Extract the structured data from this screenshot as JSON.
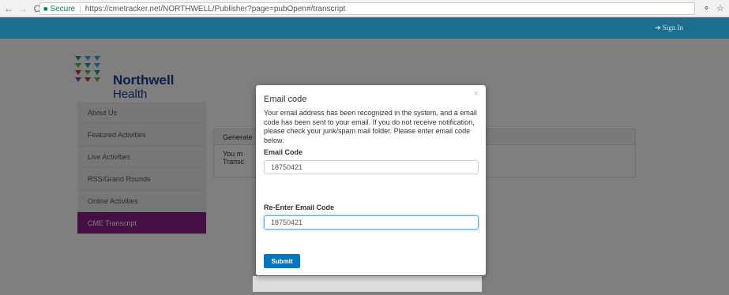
{
  "browser": {
    "back": "←",
    "forward": "→",
    "reload": "C",
    "secure_label": "Secure",
    "url": "https://cmetracker.net/NORTHWELL/Publisher?page=pubOpen#/transcript"
  },
  "header": {
    "signin_label": "Sign In"
  },
  "logo": {
    "line1": "Northwell",
    "line2": "Health"
  },
  "sidebar": {
    "items": [
      {
        "label": "About Us"
      },
      {
        "label": "Featured Activities"
      },
      {
        "label": "Live Activities"
      },
      {
        "label": "RSS/Grand Rounds"
      },
      {
        "label": "Online Activities"
      },
      {
        "label": "CME Transcript"
      }
    ]
  },
  "panel": {
    "heading": "Generate",
    "body_line1": "You m",
    "body_line2": "Transc"
  },
  "modal": {
    "title": "Email code",
    "close": "×",
    "message": "Your email address has been recognized in the system, and a email code has been sent to your email. If you do not receive notification, please check your junk/spam mail folder. Please enter email code below.",
    "field1_label": "Email Code",
    "field1_value": "18750421",
    "field2_label": "Re-Enter Email Code",
    "field2_value": "18750421",
    "submit_label": "Submit"
  },
  "colors": {
    "header": "#1b6f8d",
    "active_nav": "#8b1e88",
    "submit": "#0077bf"
  }
}
